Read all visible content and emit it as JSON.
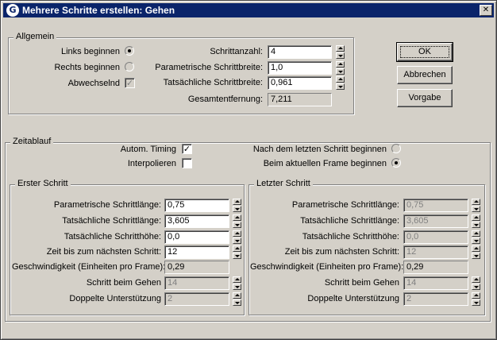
{
  "window": {
    "title": "Mehrere Schritte erstellen: Gehen",
    "icon_glyph": "G",
    "close_glyph": "✕"
  },
  "allgemein": {
    "label": "Allgemein",
    "links_label": "Links beginnen",
    "rechts_label": "Rechts beginnen",
    "abwechselnd_label": "Abwechselnd",
    "start_side": "links",
    "abwechselnd_checked": true,
    "schrittanzahl_label": "Schrittanzahl:",
    "schrittanzahl_value": "4",
    "param_breite_label": "Parametrische Schrittbreite:",
    "param_breite_value": "1,0",
    "tats_breite_label": "Tatsächliche Schrittbreite:",
    "tats_breite_value": "0,961",
    "gesamt_label": "Gesamtentfernung:",
    "gesamt_value": "7,211"
  },
  "buttons": {
    "ok": "OK",
    "abbrechen": "Abbrechen",
    "vorgabe": "Vorgabe"
  },
  "zeitablauf": {
    "label": "Zeitablauf",
    "auto_timing_label": "Autom. Timing",
    "auto_timing_checked": true,
    "interpolieren_label": "Interpolieren",
    "interpolieren_checked": false,
    "nach_letzten_label": "Nach dem letzten Schritt beginnen",
    "aktuellen_frame_label": "Beim aktuellen Frame beginnen",
    "begin_mode": "aktuell"
  },
  "erster": {
    "label": "Erster Schritt",
    "rows": [
      {
        "label": "Parametrische Schrittlänge:",
        "value": "0,75",
        "kind": "spin",
        "enabled": true
      },
      {
        "label": "Tatsächliche Schrittlänge:",
        "value": "3,605",
        "kind": "spin",
        "enabled": true
      },
      {
        "label": "Tatsächliche Schritthöhe:",
        "value": "0,0",
        "kind": "spin",
        "enabled": true
      },
      {
        "label": "Zeit bis zum nächsten Schritt:",
        "value": "12",
        "kind": "spin",
        "enabled": true
      },
      {
        "label": "Geschwindigkeit (Einheiten pro Frame):",
        "value": "0,29",
        "kind": "readonly",
        "enabled": true
      },
      {
        "label": "Schritt beim Gehen",
        "value": "14",
        "kind": "spin",
        "enabled": false
      },
      {
        "label": "Doppelte Unterstützung",
        "value": "2",
        "kind": "spin",
        "enabled": false
      }
    ]
  },
  "letzter": {
    "label": "Letzter Schritt",
    "rows": [
      {
        "label": "Parametrische Schrittlänge:",
        "value": "0,75",
        "kind": "spin",
        "enabled": false
      },
      {
        "label": "Tatsächliche Schrittlänge:",
        "value": "3,605",
        "kind": "spin",
        "enabled": false
      },
      {
        "label": "Tatsächliche Schritthöhe:",
        "value": "0,0",
        "kind": "spin",
        "enabled": false
      },
      {
        "label": "Zeit bis zum nächsten Schritt:",
        "value": "12",
        "kind": "spin",
        "enabled": false
      },
      {
        "label": "Geschwindigkeit (Einheiten pro Frame):",
        "value": "0,29",
        "kind": "readonly",
        "enabled": true
      },
      {
        "label": "Schritt beim Gehen",
        "value": "14",
        "kind": "spin",
        "enabled": false
      },
      {
        "label": "Doppelte Unterstützung",
        "value": "2",
        "kind": "spin",
        "enabled": false
      }
    ]
  }
}
